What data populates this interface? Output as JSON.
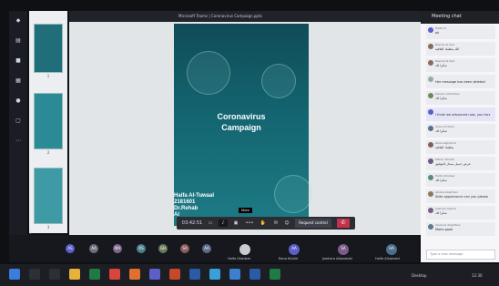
{
  "window": {
    "title": "Microsoft Teams | Coronavirus Campaign.pptx",
    "page": "1"
  },
  "rail": {
    "icons": [
      "activity-icon",
      "chat-icon",
      "teams-icon",
      "calendar-icon",
      "calls-icon",
      "files-icon",
      "apps-icon"
    ]
  },
  "thumbnails": [
    {
      "num": "1"
    },
    {
      "num": "2"
    },
    {
      "num": "3"
    }
  ],
  "slide": {
    "title_line1": "Coronavirus",
    "title_line2": "Campaign",
    "author_lines": [
      "Haifa Al-Tuwaal",
      "2181601",
      "Dr.Rehab",
      "Al"
    ]
  },
  "call": {
    "timer": "03:42:51",
    "mute_tooltip": "Mute",
    "request_control": "Request control",
    "more": "•••"
  },
  "participants": [
    {
      "initials": "AS",
      "color": "#5b5fc7"
    },
    {
      "initials": "AA",
      "color": "#6a6f7c"
    },
    {
      "initials": "MA",
      "color": "#7d6a8a"
    },
    {
      "initials": "RS",
      "color": "#4b7f8a"
    },
    {
      "initials": "GH",
      "color": "#6b7a58"
    },
    {
      "initials": "SA",
      "color": "#8a5b5b"
    },
    {
      "initials": "AA",
      "color": "#5c6b8a"
    }
  ],
  "speakers": [
    {
      "initials": "",
      "name": "Haifa Ghadeer",
      "color": "#c9cbd0"
    },
    {
      "initials": "AA",
      "name": "Rana Khalid",
      "color": "#5b5fc7"
    },
    {
      "initials": "SA",
      "name": "Jawhara Albarakati",
      "color": "#7a5b8a"
    },
    {
      "initials": "HA",
      "name": "Haifa Alhomaid",
      "color": "#4b6f8a"
    }
  ],
  "chat": {
    "header": "Meeting chat",
    "messages": [
      {
        "name": "Haifa Al",
        "text": "ok",
        "color": "#5b5fc7",
        "mine": false
      },
      {
        "name": "Reema Al-Sad",
        "text": "الله يعطيك العافية",
        "color": "#8a6b5b",
        "mine": false
      },
      {
        "name": "Reema Al-Sad",
        "text": "شكرا لك",
        "color": "#8a6b5b",
        "mine": false
      },
      {
        "name": "",
        "text": "Her message has been deleted",
        "color": "#9aa",
        "mine": false
      },
      {
        "name": "Dareen Alhindawi",
        "text": "شكرا لك",
        "color": "#6b8a5b",
        "mine": false
      },
      {
        "name": "",
        "text": "I think we advanced now, you face",
        "color": "#5b5fc7",
        "mine": true
      },
      {
        "name": "Arwa Al-Harbi",
        "text": "شكرا لك",
        "color": "#5b6f8a",
        "mine": false
      },
      {
        "name": "Rana Alghamdi",
        "text": "يعطيك العافية",
        "color": "#8a5b5b",
        "mine": false
      },
      {
        "name": "Manar Alharbi",
        "text": "عرض جميل ممتاز بالتوفيق",
        "color": "#6b5b8a",
        "mine": false
      },
      {
        "name": "Haifa Ghadeer",
        "text": "شكرا لك",
        "color": "#5b8a7a",
        "mine": false
      },
      {
        "name": "Ghada Alqahtani",
        "text": "Slide appearance can you please",
        "color": "#8a7a5b",
        "mine": false
      },
      {
        "name": "Jawhara Alsaud",
        "text": "شكرا لك",
        "color": "#7a5b8a",
        "mine": false
      },
      {
        "name": "Alanoud Alqahtani",
        "text": "Maha good",
        "color": "#5b7a8a",
        "mine": false
      }
    ],
    "compose_placeholder": "Type a new message"
  },
  "taskbar": {
    "apps": [
      {
        "name": "start-icon",
        "color": "#3b7ddd"
      },
      {
        "name": "search-icon",
        "color": "#2c2f36"
      },
      {
        "name": "task-view-icon",
        "color": "#2c2f36"
      },
      {
        "name": "file-explorer-icon",
        "color": "#e8b23a"
      },
      {
        "name": "excel-icon",
        "color": "#1f7a45"
      },
      {
        "name": "chrome-icon",
        "color": "#d8453a"
      },
      {
        "name": "firefox-icon",
        "color": "#e0702f"
      },
      {
        "name": "teams-icon",
        "color": "#5b5fc7"
      },
      {
        "name": "powerpoint-icon",
        "color": "#c8482a"
      },
      {
        "name": "word-icon",
        "color": "#2b5aa6"
      },
      {
        "name": "paint-icon",
        "color": "#3b9fd8"
      },
      {
        "name": "store-icon",
        "color": "#3c7fd0"
      },
      {
        "name": "word-doc-icon",
        "color": "#2b5aa6"
      },
      {
        "name": "excel-doc-icon",
        "color": "#1f7a45"
      }
    ],
    "status": "Desktop",
    "clock": "12:30"
  }
}
